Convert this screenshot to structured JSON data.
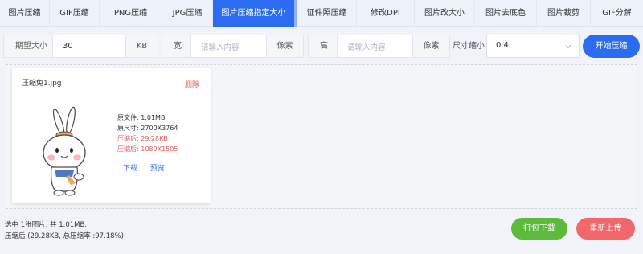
{
  "tabs": [
    {
      "label": "图片压缩",
      "active": false
    },
    {
      "label": "GIF压缩",
      "active": false
    },
    {
      "label": "PNG压缩",
      "active": false
    },
    {
      "label": "JPG压缩",
      "active": false
    },
    {
      "label": "图片压缩指定大小",
      "active": true
    },
    {
      "label": "证件照压缩",
      "active": false
    },
    {
      "label": "修改DPI",
      "active": false
    },
    {
      "label": "图片改大小",
      "active": false
    },
    {
      "label": "图片去底色",
      "active": false
    },
    {
      "label": "图片裁剪",
      "active": false
    },
    {
      "label": "GIF分解",
      "active": false
    }
  ],
  "options": {
    "expected_size_label": "期望大小",
    "expected_size_value": "30",
    "expected_size_unit": "KB",
    "width_label": "宽",
    "width_placeholder": "请输入内容",
    "width_unit": "像素",
    "height_label": "高",
    "height_placeholder": "请输入内容",
    "height_unit": "像素",
    "scale_label": "尺寸缩小",
    "scale_value": "0.4",
    "start_button": "开始压缩"
  },
  "file": {
    "name": "压缩兔1.jpg",
    "delete_label": "删除",
    "original_file": "原文件: 1.01MB",
    "original_dims": "原尺寸: 2700X3764",
    "compressed_file": "压缩后: 29.28KB",
    "compressed_dims": "压缩后: 1080X1505",
    "download_label": "下载",
    "preview_label": "预览"
  },
  "summary": {
    "line1": "选中 1张图片, 共 1.01MB,",
    "line2": "压缩后 (29.28KB, 总压缩率 :97.18%)"
  },
  "actions": {
    "pack_download": "打包下载",
    "reupload": "重新上传"
  },
  "colors": {
    "accent": "#2b6cf0",
    "danger": "#e15a55",
    "success": "#5cba3c"
  }
}
